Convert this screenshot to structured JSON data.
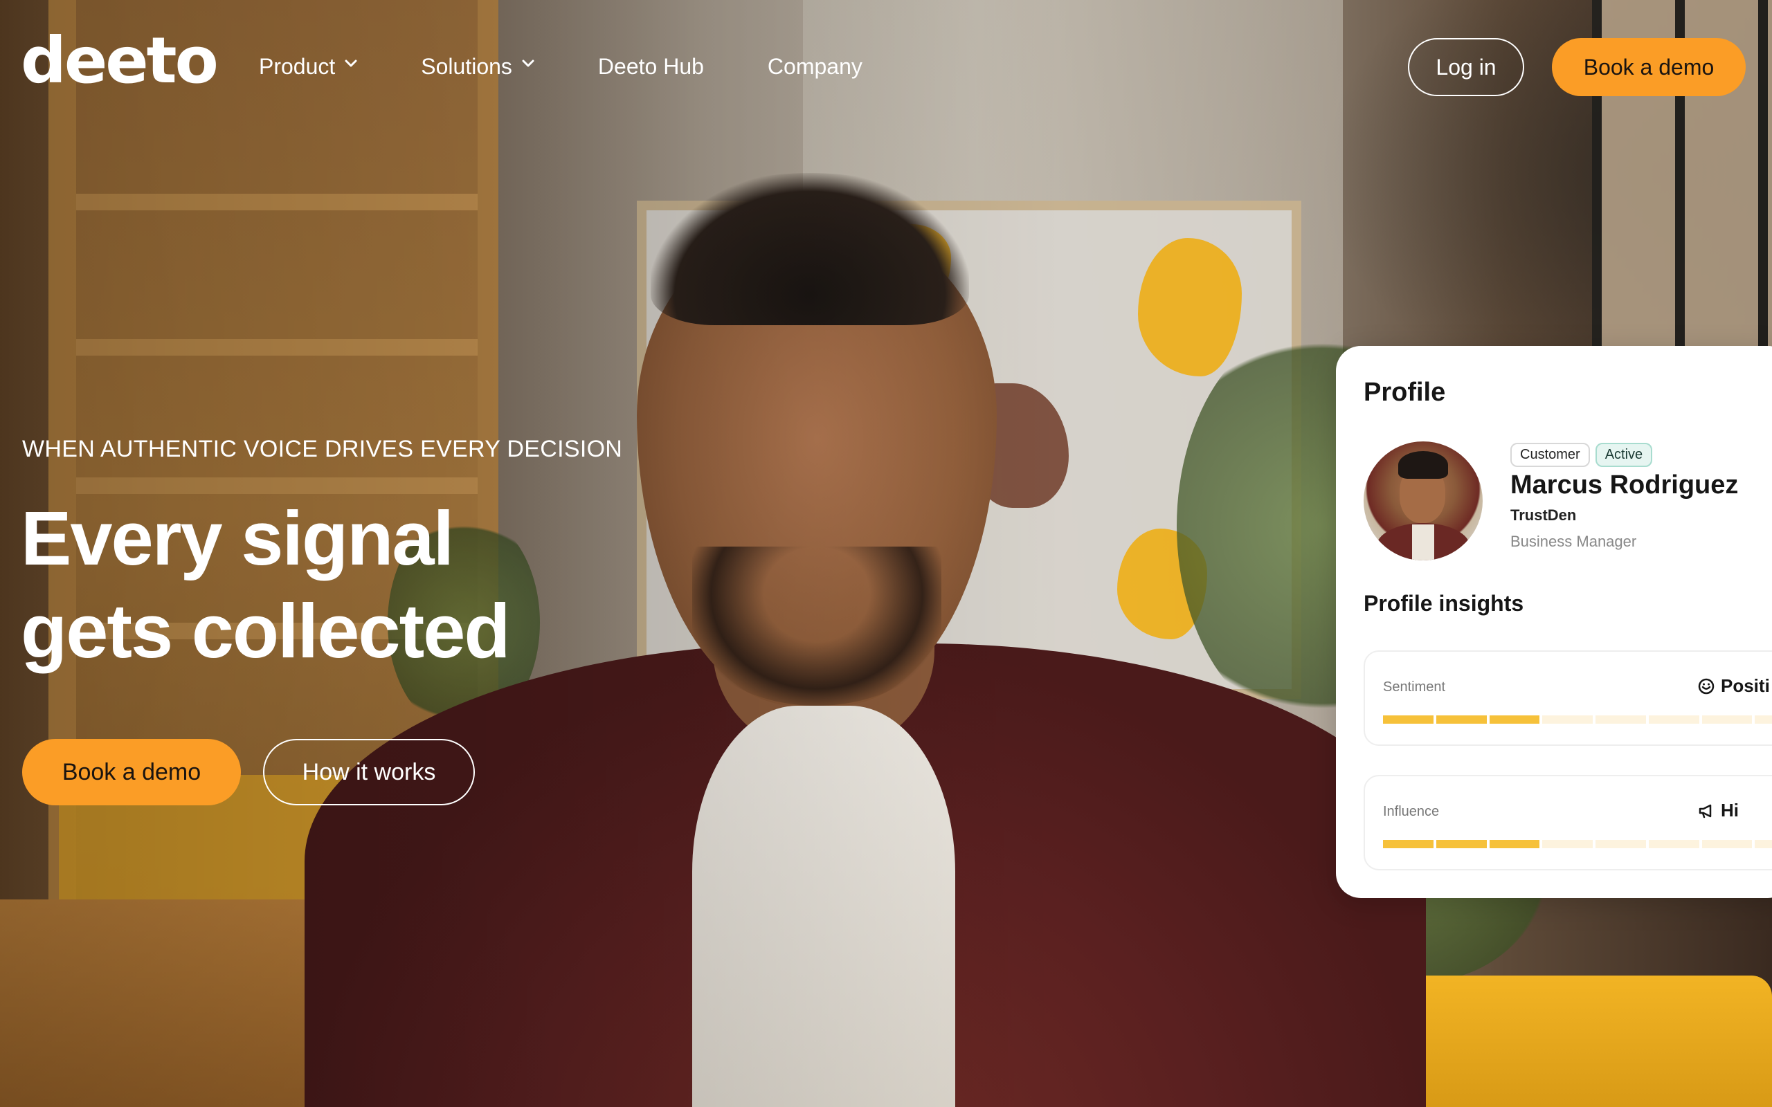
{
  "nav": {
    "logo": "deeto",
    "items": [
      {
        "label": "Product",
        "has_dropdown": true
      },
      {
        "label": "Solutions",
        "has_dropdown": true
      },
      {
        "label": "Deeto Hub",
        "has_dropdown": false
      },
      {
        "label": "Company",
        "has_dropdown": false
      }
    ],
    "login_label": "Log in",
    "demo_label": "Book a demo"
  },
  "hero": {
    "eyebrow": "WHEN AUTHENTIC VOICE DRIVES EVERY DECISION",
    "headline_line1": "Every signal",
    "headline_line2": "gets collected",
    "cta_primary": "Book a demo",
    "cta_secondary": "How it works"
  },
  "profile": {
    "title": "Profile",
    "badges": [
      "Customer",
      "Active"
    ],
    "name": "Marcus Rodriguez",
    "company": "TrustDen",
    "role": "Business Manager",
    "insights_title": "Profile insights",
    "metrics": [
      {
        "label": "Sentiment",
        "value": "Positi",
        "icon": "smile-icon",
        "level": 0.3
      },
      {
        "label": "Influence",
        "value": "Hi",
        "icon": "megaphone-icon",
        "level": 0.3
      }
    ]
  },
  "colors": {
    "accent": "#fb9d26",
    "bar_fill": "#f6c13a",
    "bar_empty": "#fdf3de",
    "badge_active_bg": "#e6f5f1"
  }
}
